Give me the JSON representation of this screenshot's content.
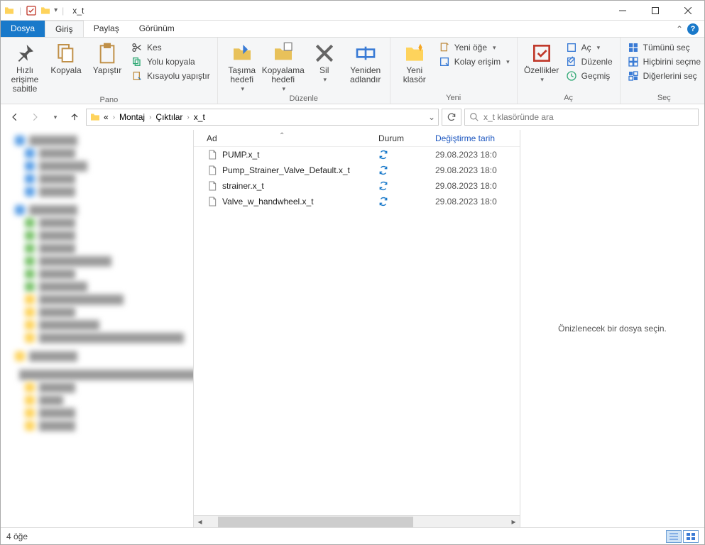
{
  "title": "x_t",
  "tabs": {
    "file": "Dosya",
    "home": "Giriş",
    "share": "Paylaş",
    "view": "Görünüm"
  },
  "ribbon": {
    "clipboard": {
      "pin": "Hızlı erişime sabitle",
      "copy": "Kopyala",
      "paste": "Yapıştır",
      "cut": "Kes",
      "copypath": "Yolu kopyala",
      "pasteshortcut": "Kısayolu yapıştır",
      "label": "Pano"
    },
    "organize": {
      "moveto": "Taşıma hedefi",
      "copyto": "Kopyalama hedefi",
      "delete": "Sil",
      "rename": "Yeniden adlandır",
      "label": "Düzenle"
    },
    "new": {
      "newfolder": "Yeni klasör",
      "newitem": "Yeni öğe",
      "easyaccess": "Kolay erişim",
      "label": "Yeni"
    },
    "open": {
      "properties": "Özellikler",
      "open": "Aç",
      "edit": "Düzenle",
      "history": "Geçmiş",
      "label": "Aç"
    },
    "select": {
      "selectall": "Tümünü seç",
      "selectnone": "Hiçbirini seçme",
      "invert": "Diğerlerini seç",
      "label": "Seç"
    }
  },
  "breadcrumb": {
    "a": "Montaj",
    "b": "Çıktılar",
    "c": "x_t"
  },
  "search_placeholder": "x_t klasöründe ara",
  "columns": {
    "name": "Ad",
    "status": "Durum",
    "date": "Değiştirme tarih"
  },
  "files": [
    {
      "name": "PUMP.x_t",
      "date": "29.08.2023 18:0"
    },
    {
      "name": "Pump_Strainer_Valve_Default.x_t",
      "date": "29.08.2023 18:0"
    },
    {
      "name": "strainer.x_t",
      "date": "29.08.2023 18:0"
    },
    {
      "name": "Valve_w_handwheel.x_t",
      "date": "29.08.2023 18:0"
    }
  ],
  "preview_empty": "Önizlenecek bir dosya seçin.",
  "status_text": "4 öğe"
}
